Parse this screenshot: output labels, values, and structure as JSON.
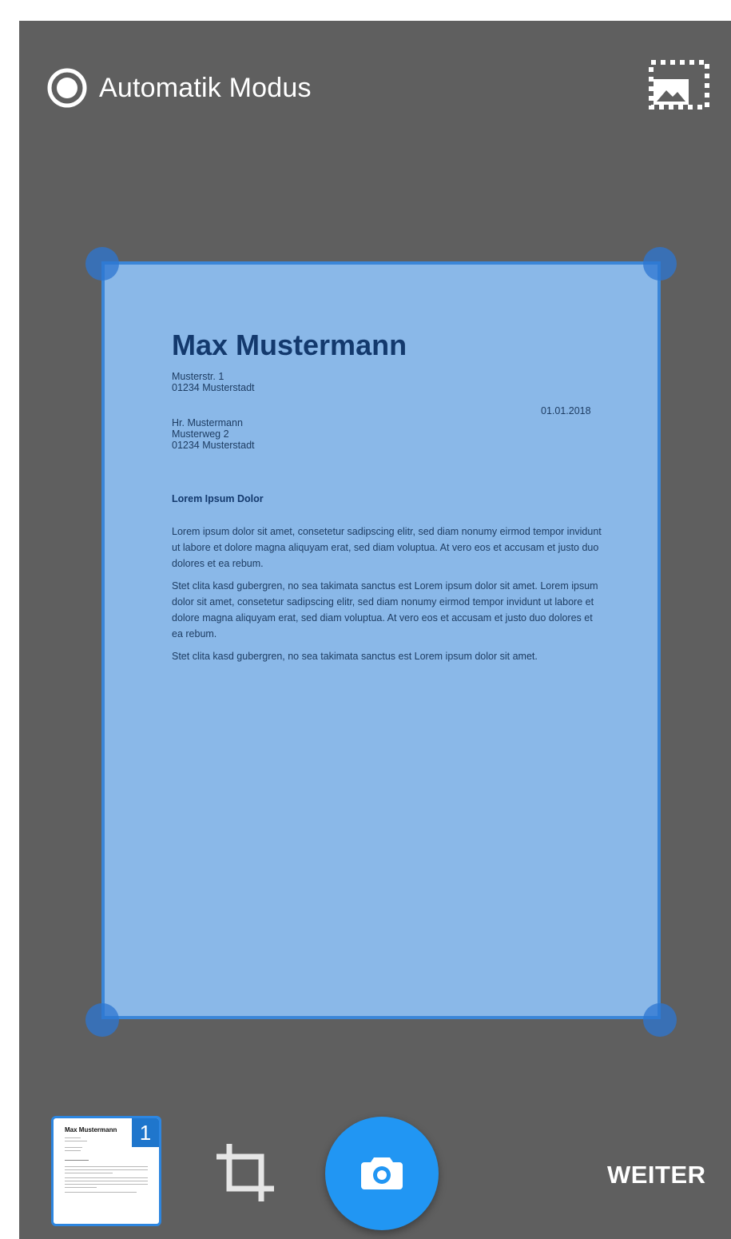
{
  "top_bar": {
    "mode_label": "Automatik Modus",
    "mode_icon": "radio-checked-icon",
    "gallery_icon": "gallery-import-icon"
  },
  "document": {
    "name": "Max Mustermann",
    "sender_street": "Musterstr. 1",
    "sender_city": "01234 Musterstadt",
    "date": "01.01.2018",
    "recipient_name": "Hr. Mustermann",
    "recipient_street": "Musterweg 2",
    "recipient_city": "01234 Musterstadt",
    "subject": "Lorem Ipsum Dolor",
    "paragraphs": [
      "Lorem ipsum dolor sit amet, consetetur sadipscing elitr, sed diam nonumy eirmod tempor invidunt ut labore et dolore magna aliquyam erat, sed diam voluptua. At vero eos et accusam et justo duo dolores et ea rebum.",
      "Stet clita kasd gubergren, no sea takimata sanctus est Lorem ipsum dolor sit amet. Lorem ipsum dolor sit amet, consetetur sadipscing elitr, sed diam nonumy eirmod tempor invidunt ut labore et dolore magna aliquyam erat, sed diam voluptua. At vero eos et accusam et justo duo dolores et ea rebum.",
      "Stet clita kasd gubergren, no sea takimata sanctus est Lorem ipsum dolor sit amet."
    ]
  },
  "bottom_bar": {
    "thumbnail_title": "Max Mustermann",
    "page_count": "1",
    "crop_icon": "crop-icon",
    "shutter_icon": "camera-icon",
    "next_label": "WEITER"
  },
  "colors": {
    "background": "#5f5f5f",
    "accent": "#2196f3",
    "overlay": "#8ab8e8",
    "border": "#3b86d8"
  }
}
